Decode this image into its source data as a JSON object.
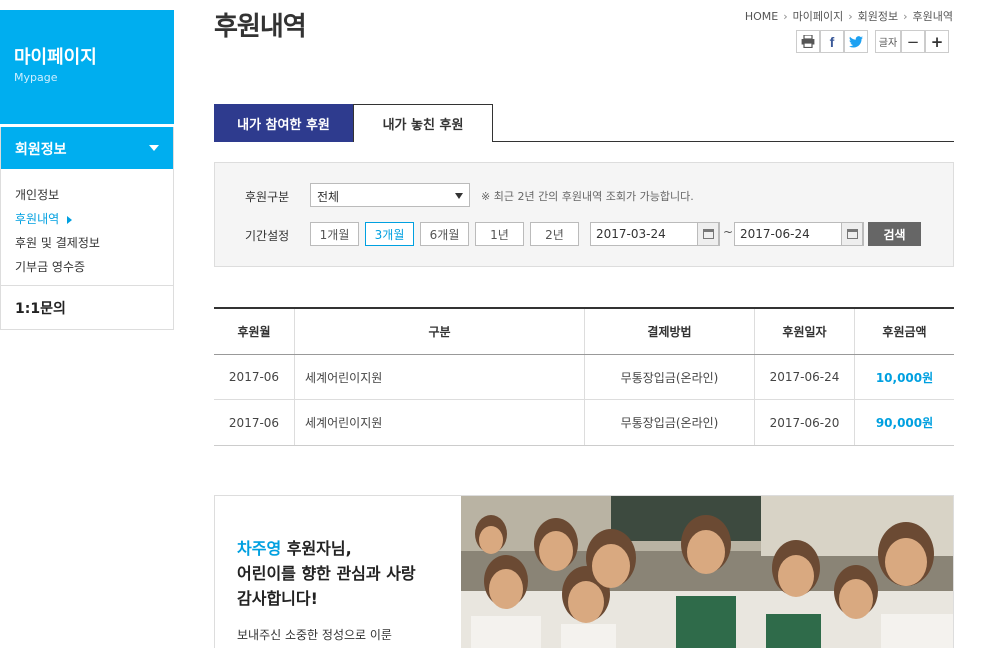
{
  "sidebar": {
    "title": "마이페이지",
    "subtitle": "Mypage",
    "section": "회원정보",
    "items": [
      "개인정보",
      "후원내역",
      "후원 및 결제정보",
      "기부금 영수증"
    ],
    "qna": "1:1문의"
  },
  "header": {
    "title": "후원내역",
    "breadcrumb": [
      "HOME",
      "마이페이지",
      "회원정보",
      "후원내역"
    ],
    "font_label": "글자",
    "font_minus": "−",
    "font_plus": "+",
    "share_facebook": "f"
  },
  "tabs": [
    "내가 참여한 후원",
    "내가 놓친 후원"
  ],
  "filter": {
    "type_label": "후원구분",
    "type_value": "전체",
    "note": "※ 최근 2년 간의 후원내역 조회가 가능합니다.",
    "period_label": "기간설정",
    "periods": [
      "1개월",
      "3개월",
      "6개월",
      "1년",
      "2년"
    ],
    "selected_period": "3개월",
    "date_from": "2017-03-24",
    "date_to": "2017-06-24",
    "tilde": "~",
    "search_label": "검색"
  },
  "table": {
    "headers": [
      "후원월",
      "구분",
      "결제방법",
      "후원일자",
      "후원금액"
    ],
    "rows": [
      [
        "2017-06",
        "세계어린이지원",
        "무통장입금(온라인)",
        "2017-06-24",
        "10,000원"
      ],
      [
        "2017-06",
        "세계어린이지원",
        "무통장입금(온라인)",
        "2017-06-20",
        "90,000원"
      ]
    ]
  },
  "banner": {
    "name": "차주영",
    "line1_suffix": " 후원자님,",
    "line2": "어린이를 향한 관심과 사랑",
    "line3": "감사합니다!",
    "sub": "보내주신 소중한 정성으로 이룬"
  },
  "colors": {
    "brand": "#00aeef",
    "tab_active": "#2e3b8e",
    "accent": "#00a0e0"
  }
}
